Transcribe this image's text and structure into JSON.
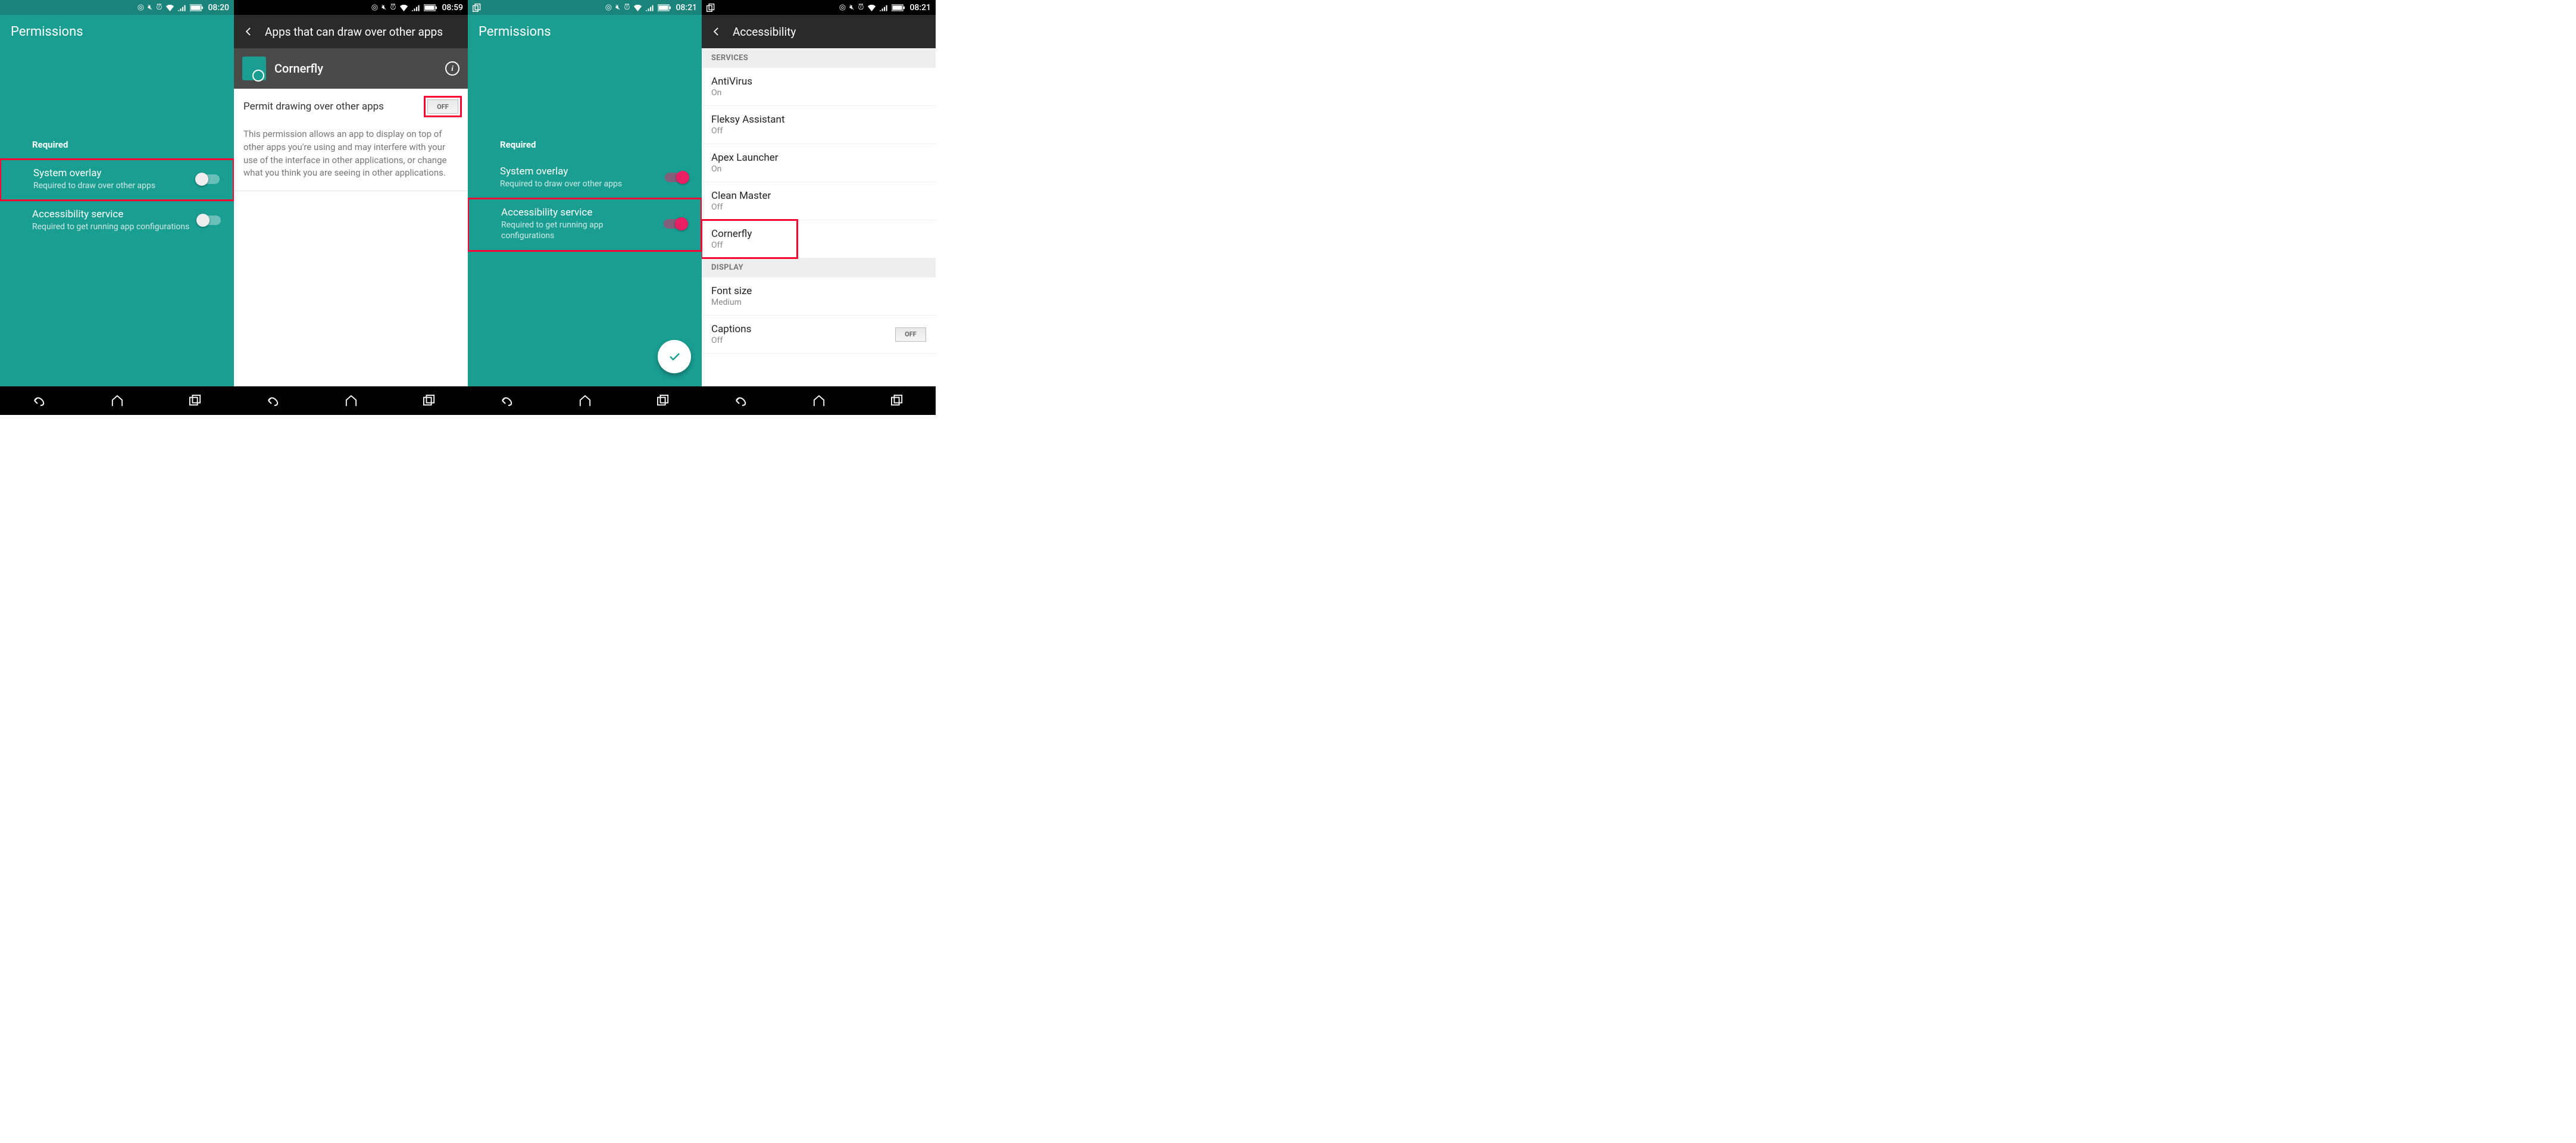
{
  "status": {
    "times": [
      "08:20",
      "08:59",
      "08:21",
      "08:21"
    ]
  },
  "screen1": {
    "title": "Permissions",
    "section": "Required",
    "overlay": {
      "title": "System overlay",
      "sub": "Required to draw over other apps"
    },
    "access": {
      "title": "Accessibility service",
      "sub": "Required to get running app configurations"
    }
  },
  "screen2": {
    "title": "Apps that can draw over other apps",
    "app": "Cornerfly",
    "permit": "Permit drawing over other apps",
    "toggle": "OFF",
    "desc": "This permission allows an app to display on top of other apps you're using and may interfere with your use of the interface in other applications, or change what you think you are seeing in other applications."
  },
  "screen3": {
    "title": "Permissions",
    "section": "Required",
    "overlay": {
      "title": "System overlay",
      "sub": "Required to draw over other apps"
    },
    "access": {
      "title": "Accessibility service",
      "sub": "Required to get running app configurations"
    }
  },
  "screen4": {
    "title": "Accessibility",
    "section_services": "SERVICES",
    "section_display": "DISPLAY",
    "items": [
      {
        "title": "AntiVirus",
        "sub": "On"
      },
      {
        "title": "Fleksy Assistant",
        "sub": "Off"
      },
      {
        "title": "Apex Launcher",
        "sub": "On"
      },
      {
        "title": "Clean Master",
        "sub": "Off"
      },
      {
        "title": "Cornerfly",
        "sub": "Off"
      }
    ],
    "display": [
      {
        "title": "Font size",
        "sub": "Medium"
      },
      {
        "title": "Captions",
        "sub": "Off",
        "toggle": "OFF"
      }
    ]
  }
}
